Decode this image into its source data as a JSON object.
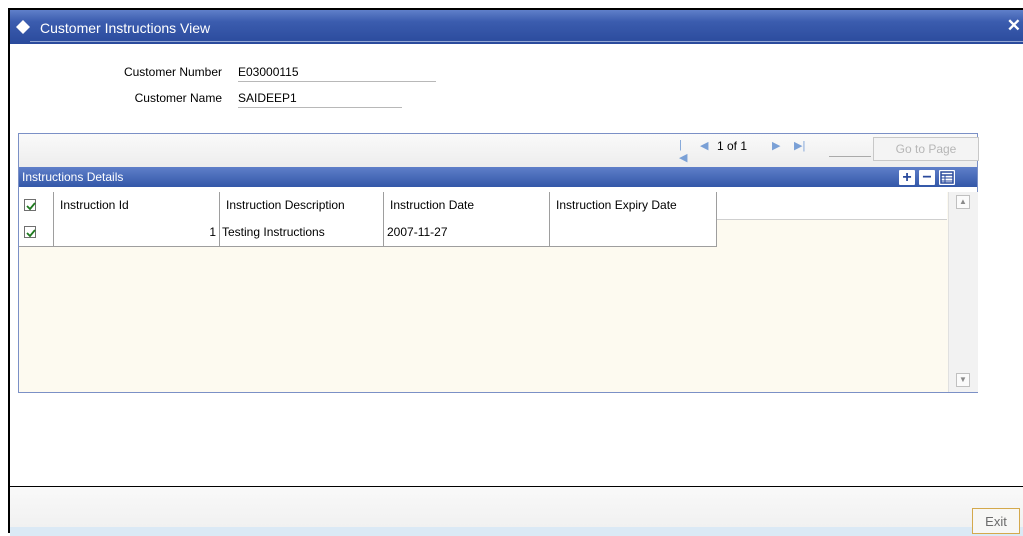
{
  "window": {
    "title": "Customer Instructions View",
    "close_symbol": "✕"
  },
  "customer": {
    "number_label": "Customer Number",
    "number_value": "E03000115",
    "name_label": "Customer Name",
    "name_value": "SAIDEEP1"
  },
  "pager": {
    "first_symbol": "|◀",
    "prev_symbol": "◀",
    "page_text": "1 of 1",
    "next_symbol": "▶",
    "last_symbol": "▶|",
    "page_input": "",
    "go_label": "Go to Page"
  },
  "section": {
    "title": "Instructions Details",
    "add_symbol": "+",
    "remove_symbol": "−"
  },
  "grid": {
    "columns": [
      "Instruction Id",
      "Instruction Description",
      "Instruction Date",
      "Instruction Expiry Date"
    ],
    "header_checked": true,
    "rows": [
      {
        "checked": true,
        "id": "1",
        "description": "Testing Instructions",
        "date": "2007-11-27",
        "expiry": ""
      }
    ]
  },
  "footer": {
    "exit_label": "Exit"
  },
  "colors": {
    "title_bar": "#3b5cae",
    "section_bar": "#3357a8",
    "grid_background": "#fdfaf0",
    "exit_border": "#d4a94c"
  }
}
